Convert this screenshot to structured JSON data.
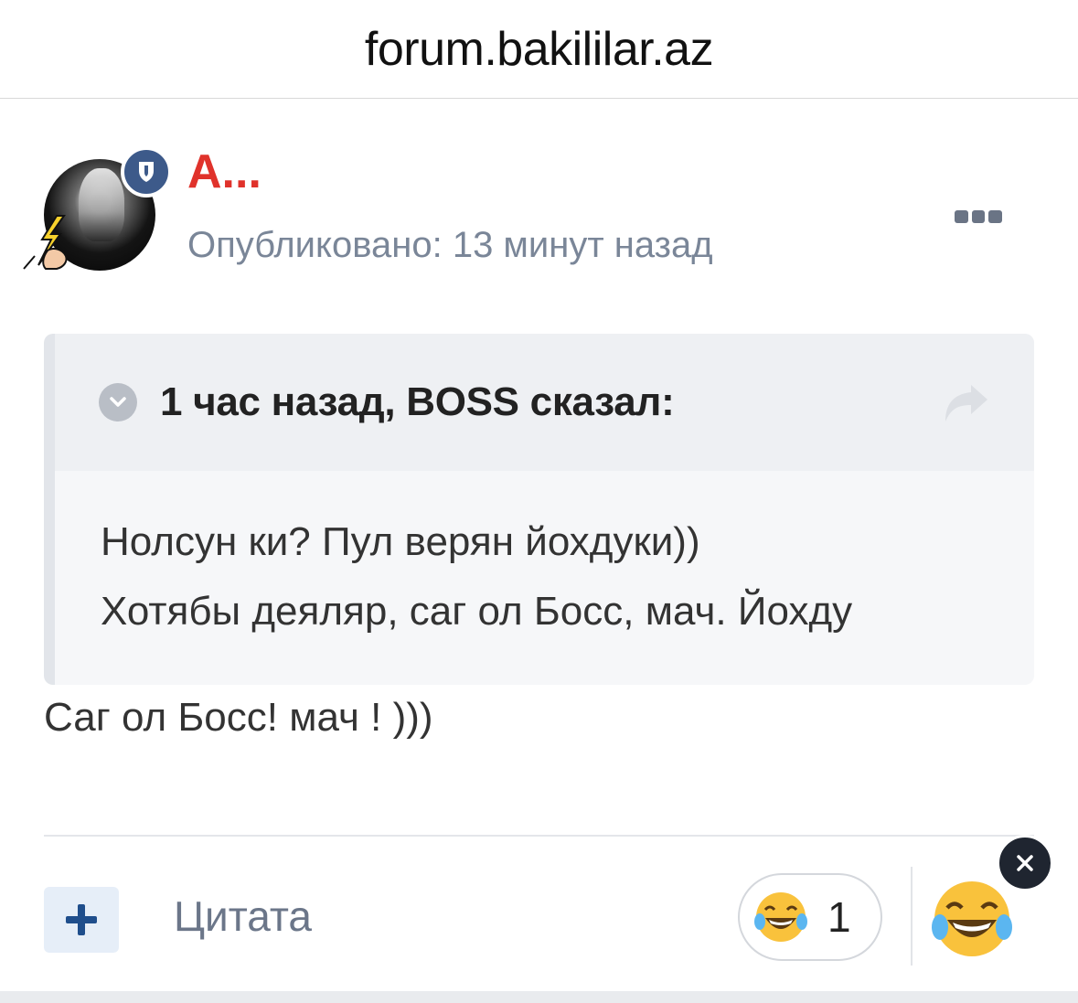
{
  "browser": {
    "url": "forum.bakililar.az"
  },
  "post": {
    "author": "A...",
    "posted": "Опубликовано: 13 минут назад",
    "quote": {
      "citation": "1 час назад, BOSS сказал:",
      "lines": [
        "Нолсун ки? Пул верян йохдуки))",
        "Хотябы деяляр, саг ол Босс, мач. Йохду"
      ]
    },
    "text": "Саг ол Босс! мач ! )))"
  },
  "actions": {
    "quote_label": "Цитата",
    "reaction_count": "1",
    "reaction_icon": "laughing-tears-emoji"
  },
  "colors": {
    "author": "#e0322b",
    "badge": "#3d5a8a",
    "muted": "#7a8698"
  }
}
